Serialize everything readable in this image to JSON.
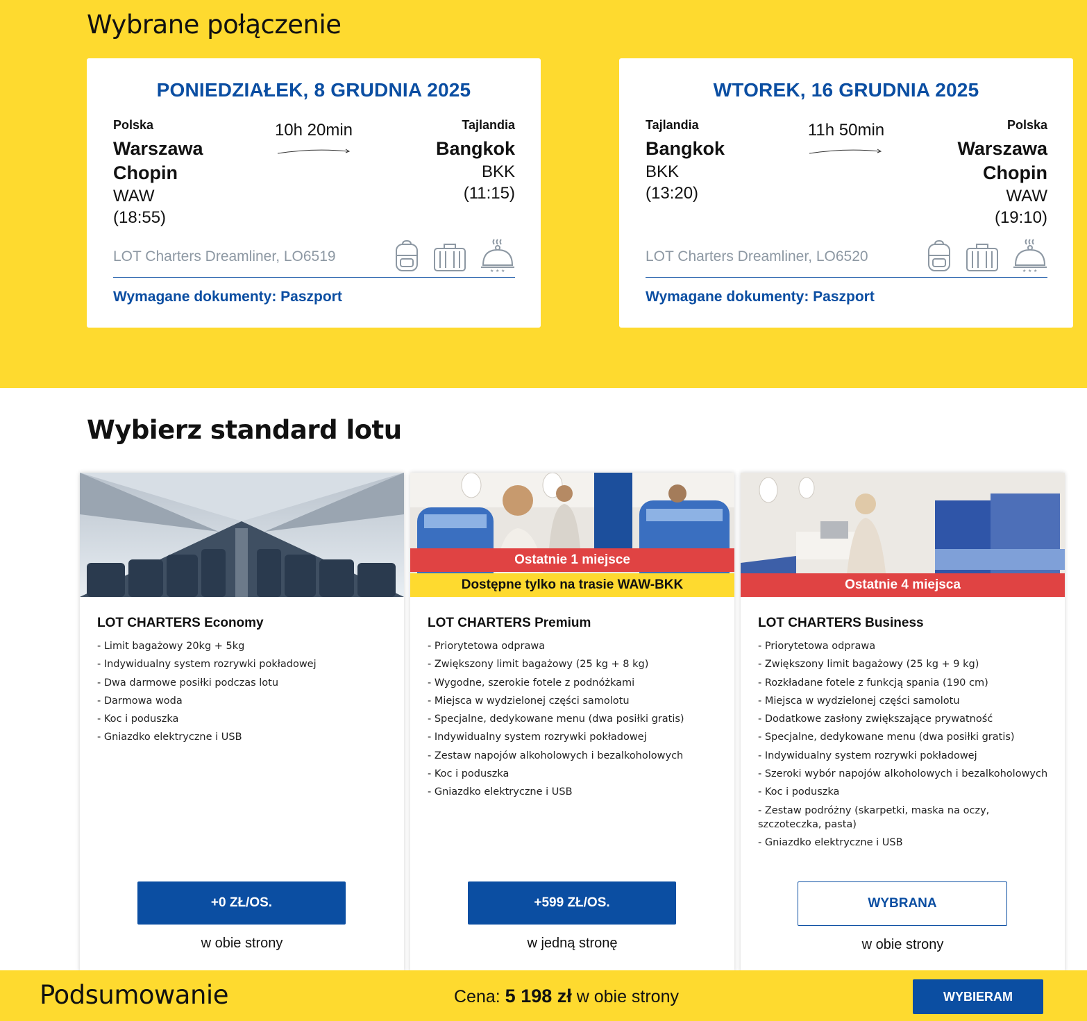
{
  "selected": {
    "title": "Wybrane połączenie",
    "outbound": {
      "date": "PONIEDZIAŁEK, 8 GRUDNIA 2025",
      "from_country": "Polska",
      "from_city_1": "Warszawa",
      "from_city_2": "Chopin",
      "from_code": "WAW",
      "from_time": "(18:55)",
      "duration": "10h 20min",
      "to_country": "Tajlandia",
      "to_city": "Bangkok",
      "to_code": "BKK",
      "to_time": "(11:15)",
      "aircraft": "LOT Charters Dreamliner, LO6519",
      "documents": "Wymagane dokumenty: Paszport"
    },
    "return": {
      "date": "WTOREK, 16 GRUDNIA 2025",
      "from_country": "Tajlandia",
      "from_city": "Bangkok",
      "from_code": "BKK",
      "from_time": "(13:20)",
      "duration": "11h 50min",
      "to_country": "Polska",
      "to_city_1": "Warszawa",
      "to_city_2": "Chopin",
      "to_code": "WAW",
      "to_time": "(19:10)",
      "aircraft": "LOT Charters Dreamliner, LO6520",
      "documents": "Wymagane dokumenty: Paszport"
    },
    "icons": [
      "backpack-icon",
      "suitcase-icon",
      "meal-cloche-icon"
    ]
  },
  "standard": {
    "title": "Wybierz standard lotu",
    "fares": [
      {
        "name": "LOT CHARTERS Economy",
        "features": [
          "- Limit bagażowy 20kg + 5kg",
          "- Indywidualny system rozrywki pokładowej",
          "- Dwa darmowe posiłki podczas lotu",
          "- Darmowa woda",
          "- Koc i poduszka",
          "- Gniazdko elektryczne i USB"
        ],
        "button": "+0 ZŁ/OS.",
        "direction": "w obie strony"
      },
      {
        "name": "LOT CHARTERS Premium",
        "badge_red": "Ostatnie 1 miejsce",
        "badge_yellow": "Dostępne tylko na trasie WAW-BKK",
        "features": [
          "- Priorytetowa odprawa",
          "- Zwiększony limit bagażowy (25 kg + 8 kg)",
          "- Wygodne, szerokie fotele z podnóżkami",
          "- Miejsca w wydzielonej części samolotu",
          "- Specjalne, dedykowane menu (dwa posiłki gratis)",
          "- Indywidualny system rozrywki pokładowej",
          "- Zestaw napojów alkoholowych i bezalkoholowych",
          "- Koc i poduszka",
          "- Gniazdko elektryczne i USB"
        ],
        "button": "+599 ZŁ/OS.",
        "direction": "w jedną stronę"
      },
      {
        "name": "LOT CHARTERS Business",
        "badge_red": "Ostatnie 4 miejsca",
        "features": [
          "- Priorytetowa odprawa",
          "- Zwiększony limit bagażowy (25 kg + 9 kg)",
          "- Rozkładane fotele z funkcją spania (190 cm)",
          "- Miejsca w wydzielonej części samolotu",
          "- Dodatkowe zasłony zwiększające prywatność",
          "- Specjalne, dedykowane menu (dwa posiłki gratis)",
          "- Indywidualny system rozrywki pokładowej",
          "- Szeroki wybór napojów alkoholowych i bezalkoholowych",
          "- Koc i poduszka",
          "- Zestaw podróżny (skarpetki, maska na oczy, szczoteczka, pasta)",
          "- Gniazdko elektryczne i USB"
        ],
        "button": "WYBRANA",
        "direction": "w obie strony"
      }
    ]
  },
  "summary": {
    "title": "Podsumowanie",
    "price_label": "Cena:",
    "price_amount": "5 198 zł",
    "price_suffix": "w obie strony",
    "choose_button": "WYBIERAM"
  },
  "colors": {
    "brand_yellow": "#FEDA2F",
    "brand_blue": "#0B4EA2",
    "badge_red": "#E04343"
  }
}
